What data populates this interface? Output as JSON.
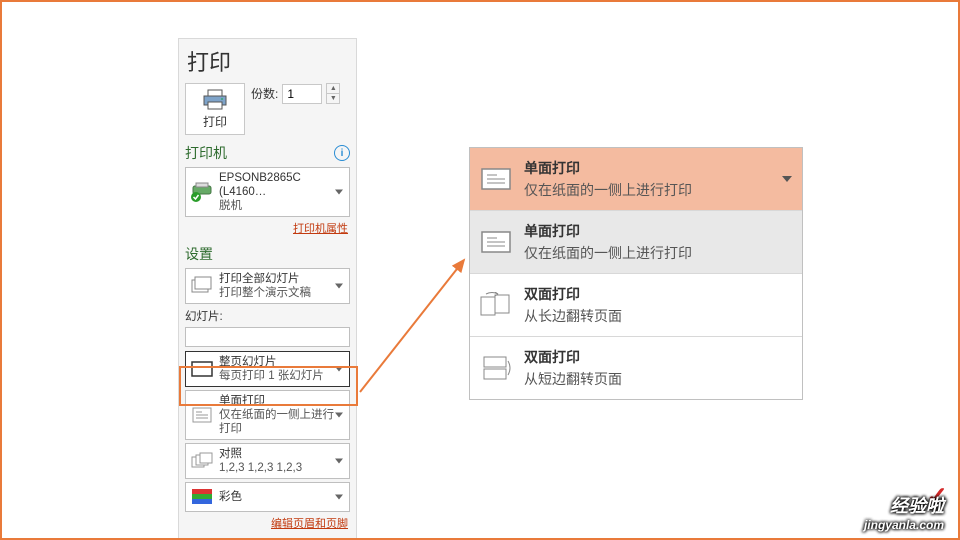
{
  "title": "打印",
  "copies": {
    "label": "份数:",
    "value": "1"
  },
  "printBtn": "打印",
  "sections": {
    "printer": "打印机",
    "settings": "设置"
  },
  "printer": {
    "name": "EPSONB2865C (L4160…",
    "status": "脱机",
    "propsLink": "打印机属性"
  },
  "slidesLabel": "幻灯片:",
  "dd": {
    "allSlides": {
      "t1": "打印全部幻灯片",
      "t2": "打印整个演示文稿"
    },
    "fullPage": {
      "t1": "整页幻灯片",
      "t2": "每页打印 1 张幻灯片"
    },
    "singleSided": {
      "t1": "单面打印",
      "t2": "仅在纸面的一侧上进行打印"
    },
    "collate": {
      "t1": "对照",
      "t2": "1,2,3   1,2,3   1,2,3"
    },
    "color": {
      "t1": "彩色"
    }
  },
  "editLink": "编辑页眉和页脚",
  "popout": {
    "header": {
      "t1": "单面打印",
      "t2": "仅在纸面的一侧上进行打印"
    },
    "opt1": {
      "t1": "单面打印",
      "t2": "仅在纸面的一侧上进行打印"
    },
    "opt2": {
      "t1": "双面打印",
      "t2": "从长边翻转页面"
    },
    "opt3": {
      "t1": "双面打印",
      "t2": "从短边翻转页面"
    }
  },
  "watermark": {
    "top": "经验啦",
    "bot": "jingyanla.com"
  }
}
